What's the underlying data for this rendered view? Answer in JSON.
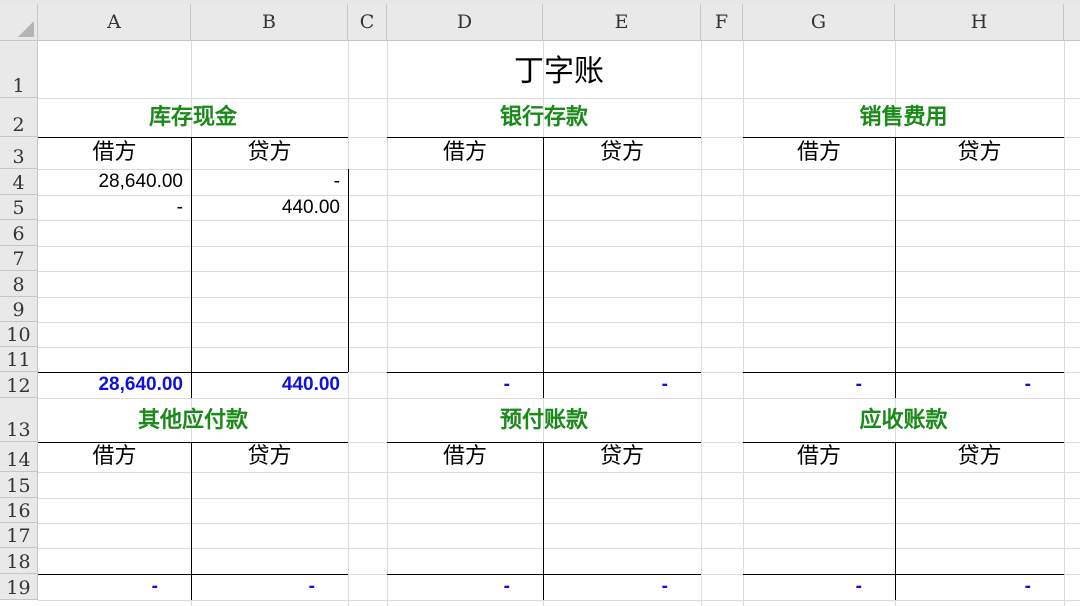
{
  "columns": [
    "A",
    "B",
    "C",
    "D",
    "E",
    "F",
    "G",
    "H"
  ],
  "rows": [
    "1",
    "2",
    "3",
    "4",
    "5",
    "6",
    "7",
    "8",
    "9",
    "10",
    "11",
    "12",
    "13",
    "14",
    "15",
    "16",
    "17",
    "18",
    "19"
  ],
  "title": "丁字账",
  "accounts": [
    {
      "name": "库存现金",
      "debit_label": "借方",
      "credit_label": "贷方",
      "entries": [
        {
          "debit": "28,640.00",
          "credit": "-"
        },
        {
          "debit": "-",
          "credit": "440.00"
        }
      ],
      "total_debit": "28,640.00",
      "total_credit": "440.00"
    },
    {
      "name": "银行存款",
      "debit_label": "借方",
      "credit_label": "贷方",
      "entries": [],
      "total_debit": "-",
      "total_credit": "-"
    },
    {
      "name": "销售费用",
      "debit_label": "借方",
      "credit_label": "贷方",
      "entries": [],
      "total_debit": "-",
      "total_credit": "-"
    },
    {
      "name": "其他应付款",
      "debit_label": "借方",
      "credit_label": "贷方",
      "entries": [],
      "total_debit": "-",
      "total_credit": "-"
    },
    {
      "name": "预付账款",
      "debit_label": "借方",
      "credit_label": "贷方",
      "entries": [],
      "total_debit": "-",
      "total_credit": "-"
    },
    {
      "name": "应收账款",
      "debit_label": "借方",
      "credit_label": "贷方",
      "entries": [],
      "total_debit": "-",
      "total_credit": "-"
    }
  ],
  "colors": {
    "account_title": "#1b8a1b",
    "total": "#1010e0"
  }
}
